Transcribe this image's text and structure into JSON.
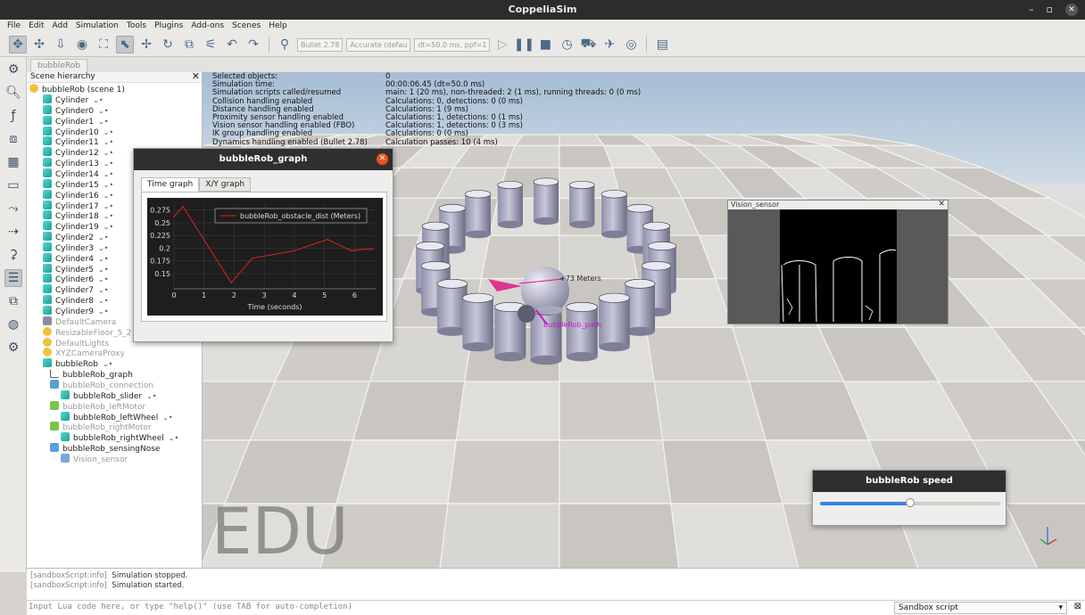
{
  "window": {
    "title": "CoppeliaSim",
    "min_icon": "–",
    "max_icon": "▫",
    "close_icon": "✕"
  },
  "menu": [
    "File",
    "Edit",
    "Add",
    "Simulation",
    "Tools",
    "Plugins",
    "Add-ons",
    "Scenes",
    "Help"
  ],
  "toolbar": {
    "engine": "Bullet 2.78",
    "accuracy": "Accurate (defau",
    "timestep": "dt=50.0 ms, ppf=1"
  },
  "scene_tab": "bubbleRob",
  "hierarchy": {
    "title": "Scene hierarchy",
    "close": "✕",
    "root": "bubbleRob (scene 1)",
    "items": [
      {
        "label": "Cylinder",
        "level": 1,
        "kind": "cyl"
      },
      {
        "label": "Cylinder0",
        "level": 1,
        "kind": "cyl"
      },
      {
        "label": "Cylinder1",
        "level": 1,
        "kind": "cyl"
      },
      {
        "label": "Cylinder10",
        "level": 1,
        "kind": "cyl"
      },
      {
        "label": "Cylinder11",
        "level": 1,
        "kind": "cyl"
      },
      {
        "label": "Cylinder12",
        "level": 1,
        "kind": "cyl"
      },
      {
        "label": "Cylinder13",
        "level": 1,
        "kind": "cyl"
      },
      {
        "label": "Cylinder14",
        "level": 1,
        "kind": "cyl"
      },
      {
        "label": "Cylinder15",
        "level": 1,
        "kind": "cyl"
      },
      {
        "label": "Cylinder16",
        "level": 1,
        "kind": "cyl"
      },
      {
        "label": "Cylinder17",
        "level": 1,
        "kind": "cyl"
      },
      {
        "label": "Cylinder18",
        "level": 1,
        "kind": "cyl"
      },
      {
        "label": "Cylinder19",
        "level": 1,
        "kind": "cyl"
      },
      {
        "label": "Cylinder2",
        "level": 1,
        "kind": "cyl"
      },
      {
        "label": "Cylinder3",
        "level": 1,
        "kind": "cyl"
      },
      {
        "label": "Cylinder4",
        "level": 1,
        "kind": "cyl"
      },
      {
        "label": "Cylinder5",
        "level": 1,
        "kind": "cyl"
      },
      {
        "label": "Cylinder6",
        "level": 1,
        "kind": "cyl"
      },
      {
        "label": "Cylinder7",
        "level": 1,
        "kind": "cyl"
      },
      {
        "label": "Cylinder8",
        "level": 1,
        "kind": "cyl"
      },
      {
        "label": "Cylinder9",
        "level": 1,
        "kind": "cyl"
      },
      {
        "label": "DefaultCamera",
        "level": 1,
        "kind": "cam",
        "dim": true
      },
      {
        "label": "ResizableFloor_5_2",
        "level": 1,
        "kind": "grp",
        "dim": true
      },
      {
        "label": "DefaultLights",
        "level": 1,
        "kind": "grp",
        "dim": true
      },
      {
        "label": "XYZCameraProxy",
        "level": 1,
        "kind": "grp",
        "dim": true
      },
      {
        "label": "bubbleRob",
        "level": 1,
        "kind": "cyl"
      },
      {
        "label": "bubbleRob_graph",
        "level": 2,
        "kind": "gra"
      },
      {
        "label": "bubbleRob_connection",
        "level": 2,
        "kind": "ss",
        "dim": true
      },
      {
        "label": "bubbleRob_slider",
        "level": 3,
        "kind": "cyl"
      },
      {
        "label": "bubbleRob_leftMotor",
        "level": 2,
        "kind": "mot",
        "dim": true
      },
      {
        "label": "bubbleRob_leftWheel",
        "level": 3,
        "kind": "cyl"
      },
      {
        "label": "bubbleRob_rightMotor",
        "level": 2,
        "kind": "mot",
        "dim": true
      },
      {
        "label": "bubbleRob_rightWheel",
        "level": 3,
        "kind": "cyl"
      },
      {
        "label": "bubbleRob_sensingNose",
        "level": 2,
        "kind": "ss"
      },
      {
        "label": "Vision_sensor",
        "level": 3,
        "kind": "vs",
        "dim": true
      }
    ]
  },
  "sim_info": [
    {
      "label": "Selected objects:",
      "value": "0"
    },
    {
      "label": "Simulation time:",
      "value": "00:00:06.45 (dt=50.0 ms)"
    },
    {
      "label": "Simulation scripts called/resumed",
      "value": "main: 1 (20 ms), non-threaded: 2 (1 ms), running threads: 0 (0 ms)"
    },
    {
      "label": "Collision handling enabled",
      "value": "Calculations: 0, detections: 0 (0 ms)"
    },
    {
      "label": "Distance handling enabled",
      "value": "Calculations: 1 (9 ms)"
    },
    {
      "label": "Proximity sensor handling enabled",
      "value": "Calculations: 1, detections: 0 (1 ms)"
    },
    {
      "label": "Vision sensor handling enabled (FBO)",
      "value": "Calculations: 1, detections: 0 (3 ms)"
    },
    {
      "label": "IK group handling enabled",
      "value": "Calculations: 0 (0 ms)"
    },
    {
      "label": "Dynamics handling enabled (Bullet 2.78)",
      "value": "Calculation passes: 10 (4 ms)"
    }
  ],
  "edu_watermark": "EDU",
  "scene_labels": {
    "distance": "+73 Meters",
    "path": "bubbleRob_path"
  },
  "graph_window": {
    "title": "bubbleRob_graph",
    "tabs": [
      "Time graph",
      "X/Y graph"
    ],
    "active_tab": 0
  },
  "chart_data": {
    "type": "line",
    "xlabel": "Time (seconds)",
    "ylabel": "",
    "xlim": [
      0,
      6.7
    ],
    "ylim": [
      0.12,
      0.285
    ],
    "xticks": [
      0,
      1,
      2,
      3,
      4,
      5,
      6
    ],
    "yticks": [
      0.15,
      0.175,
      0.2,
      0.225,
      0.25,
      0.275
    ],
    "ytick_labels": [
      "0.15",
      "0.175",
      "0.2",
      "0.225",
      "0.25",
      "0.275"
    ],
    "series": [
      {
        "name": "bubbleRob_obstacle_dist (Meters)",
        "color": "#e02020",
        "x": [
          0,
          0.3,
          1.9,
          2.6,
          4.0,
          5.1,
          5.9,
          6.3,
          6.6
        ],
        "y": [
          0.262,
          0.282,
          0.132,
          0.18,
          0.195,
          0.217,
          0.195,
          0.198,
          0.198
        ]
      }
    ],
    "grid": true,
    "legend": "top-right",
    "background": "#1e1e1e"
  },
  "vision_sensor": {
    "title": "Vision_sensor",
    "close": "✕"
  },
  "speed_window": {
    "title": "bubbleRob speed",
    "value": 0.5
  },
  "console": [
    {
      "tag": "[sandboxScript:info]",
      "text": "Simulation stopped."
    },
    {
      "tag": "[sandboxScript:info]",
      "text": "Simulation started."
    }
  ],
  "lua": {
    "placeholder": "Input Lua code here, or type \"help()\" (use TAB for auto-completion)",
    "script_select": "Sandbox script",
    "close": "⊠"
  },
  "colors": {
    "accent": "#3584e4",
    "close": "#e95420",
    "series": "#e02020"
  }
}
